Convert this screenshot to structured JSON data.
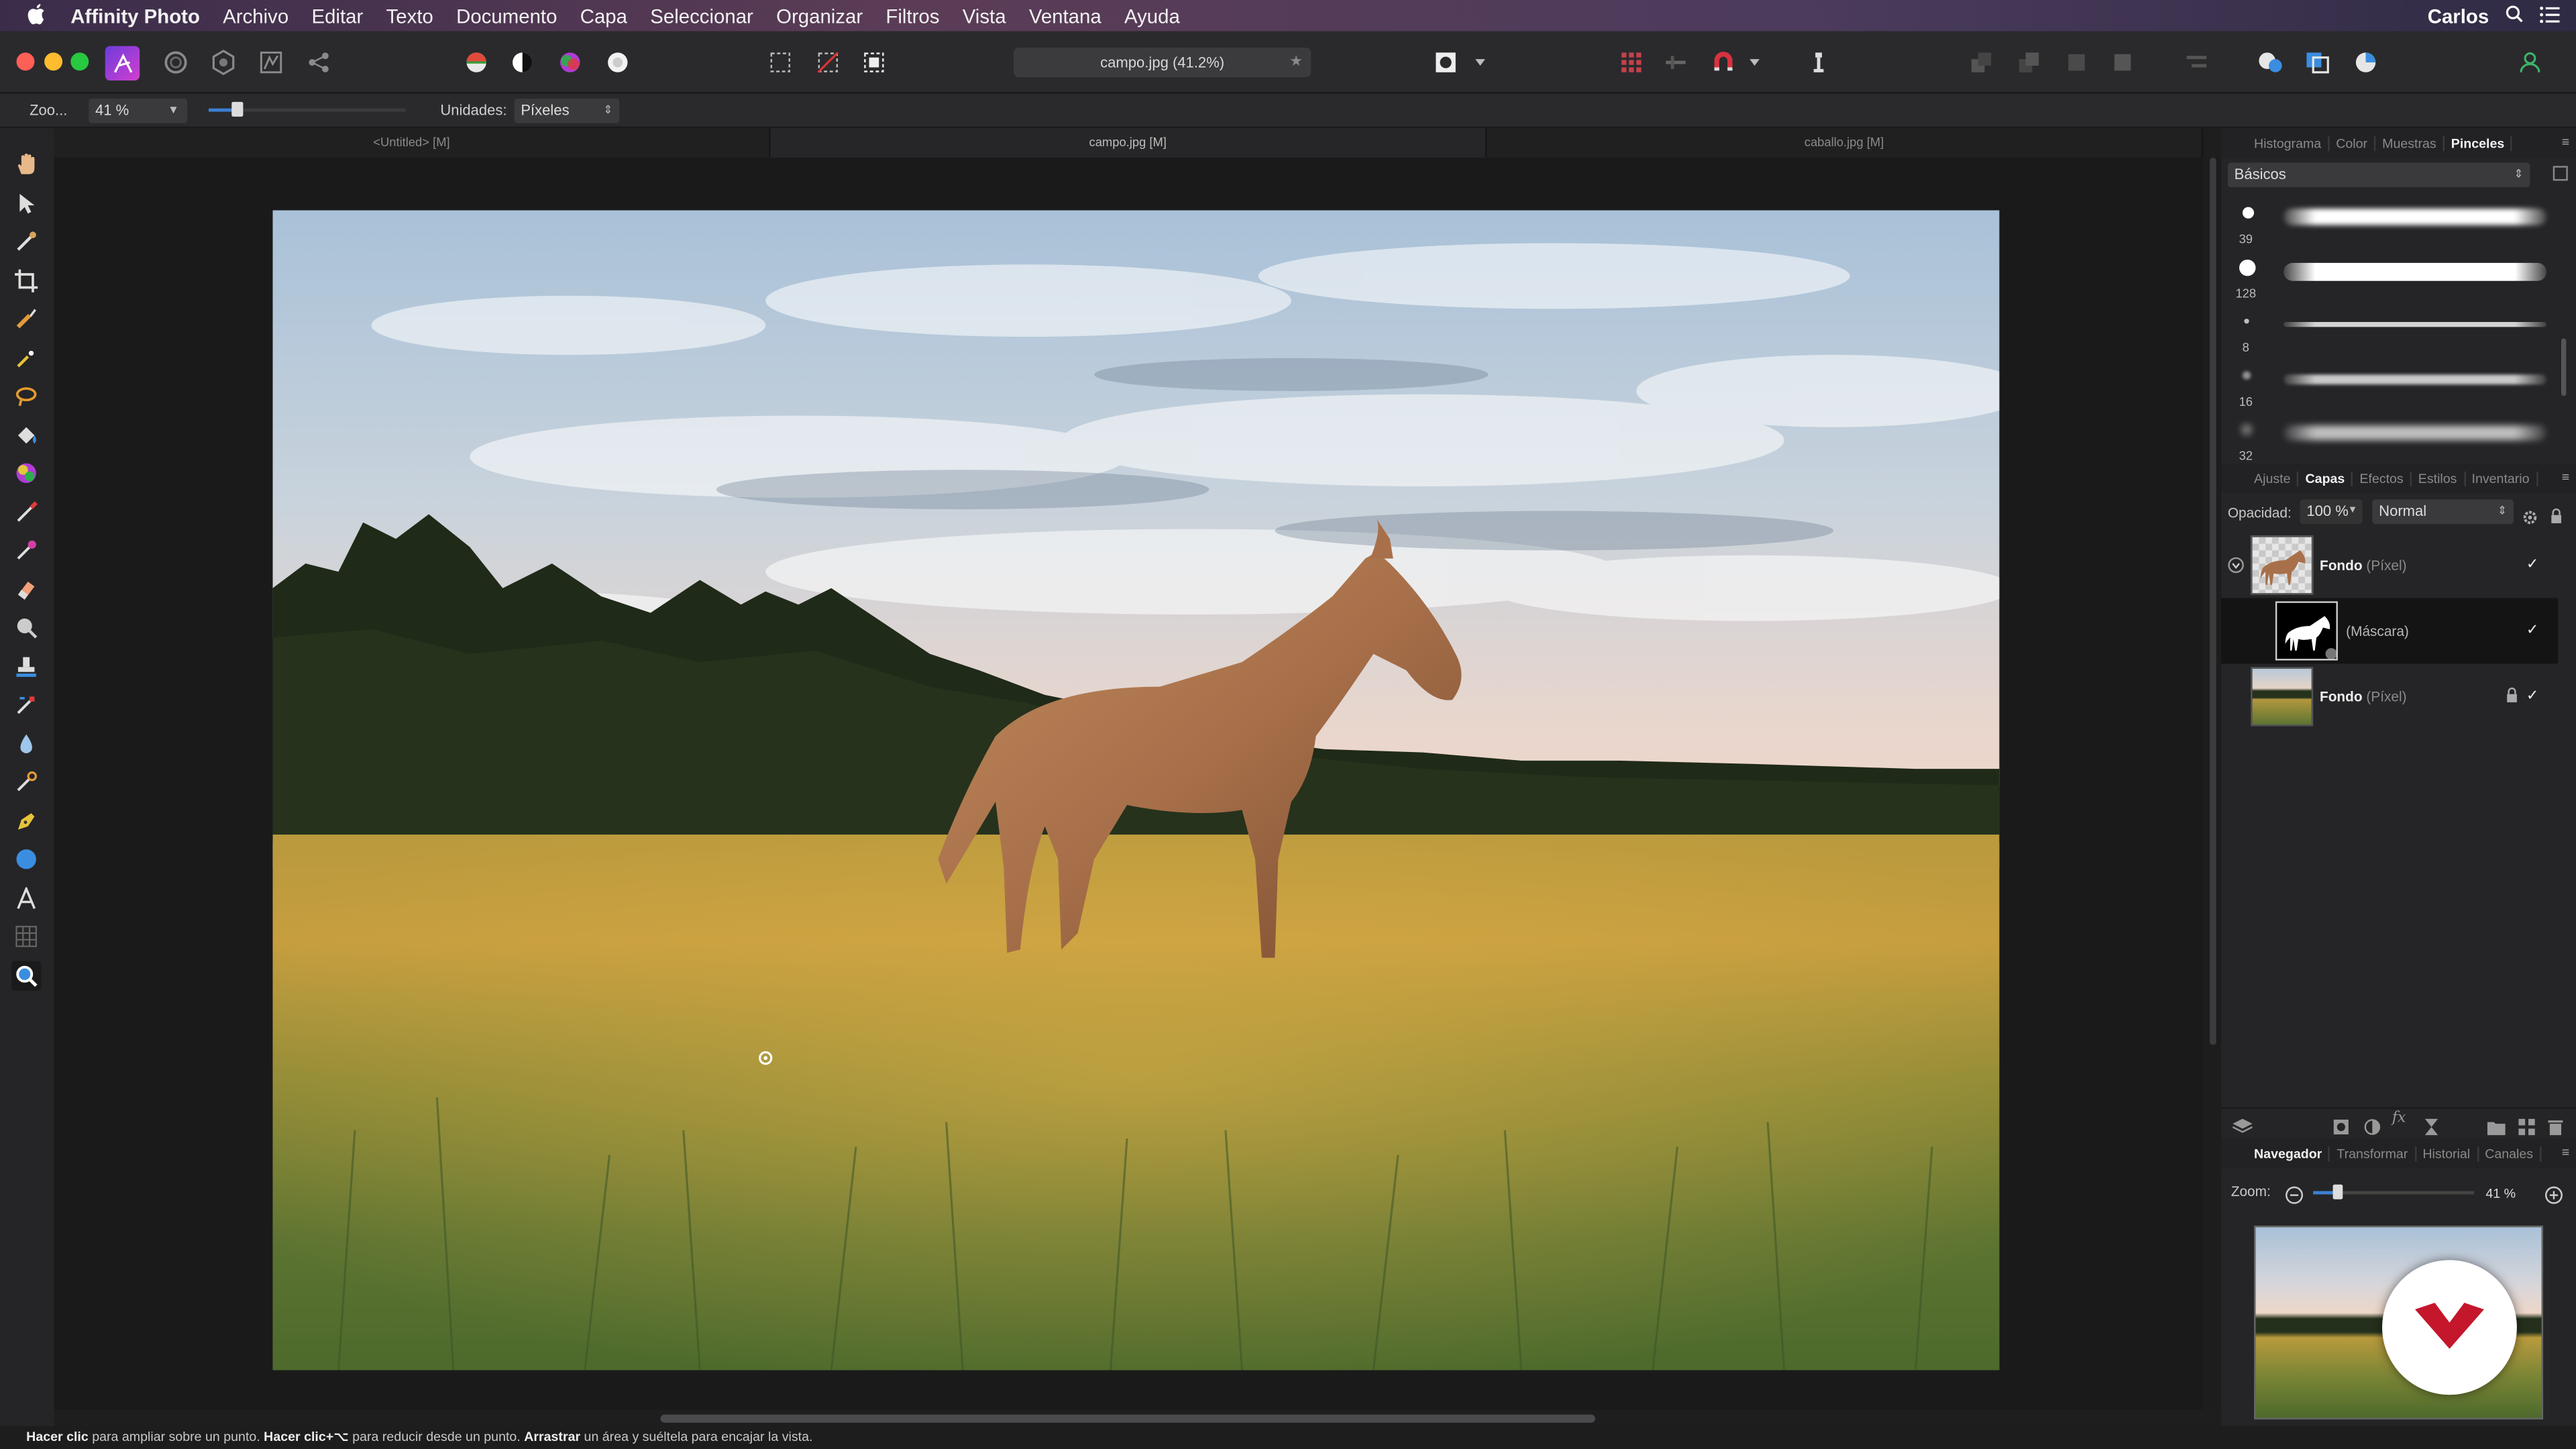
{
  "menubar": {
    "apple": "",
    "app_name": "Affinity Photo",
    "items": [
      "Archivo",
      "Editar",
      "Texto",
      "Documento",
      "Capa",
      "Seleccionar",
      "Organizar",
      "Filtros",
      "Vista",
      "Ventana",
      "Ayuda"
    ],
    "user": "Carlos"
  },
  "toolbar": {
    "document_title": "campo.jpg (41.2%)"
  },
  "context": {
    "zoom_label": "Zoo...",
    "zoom_value": "41 %",
    "units_label": "Unidades:",
    "units_value": "Píxeles"
  },
  "tabs": [
    {
      "label": "<Untitled> [M]"
    },
    {
      "label": "campo.jpg [M]"
    },
    {
      "label": "caballo.jpg [M]"
    }
  ],
  "brushes_panel": {
    "tabs": [
      "Histograma",
      "Color",
      "Muestras",
      "Pinceles"
    ],
    "active_tab": "Pinceles",
    "category": "Básicos",
    "brushes": [
      {
        "size": "39"
      },
      {
        "size": "128"
      },
      {
        "size": "8"
      },
      {
        "size": "16"
      },
      {
        "size": "32"
      }
    ]
  },
  "layers_panel": {
    "tabs": [
      "Ajuste",
      "Capas",
      "Efectos",
      "Estilos",
      "Inventario"
    ],
    "active_tab": "Capas",
    "opacity_label": "Opacidad:",
    "opacity_value": "100 %",
    "blend_mode": "Normal",
    "layers": [
      {
        "name": "Fondo",
        "type": "(Píxel)"
      },
      {
        "name": "",
        "type": "(Máscara)"
      },
      {
        "name": "Fondo",
        "type": "(Píxel)"
      }
    ]
  },
  "navigator_panel": {
    "tabs": [
      "Navegador",
      "Transformar",
      "Historial",
      "Canales"
    ],
    "active_tab": "Navegador",
    "zoom_label": "Zoom:",
    "zoom_value": "41 %"
  },
  "status": {
    "b1": "Hacer clic",
    "t1": " para ampliar sobre un punto. ",
    "b2": "Hacer clic+⌥",
    "t2": " para reducir desde un punto. ",
    "b3": "Arrastrar",
    "t3": " un área y suéltela para encajar la vista."
  },
  "colors": {
    "accent": "#c4172c",
    "panel": "#252527",
    "canvas_bg": "#1a1a1b"
  }
}
